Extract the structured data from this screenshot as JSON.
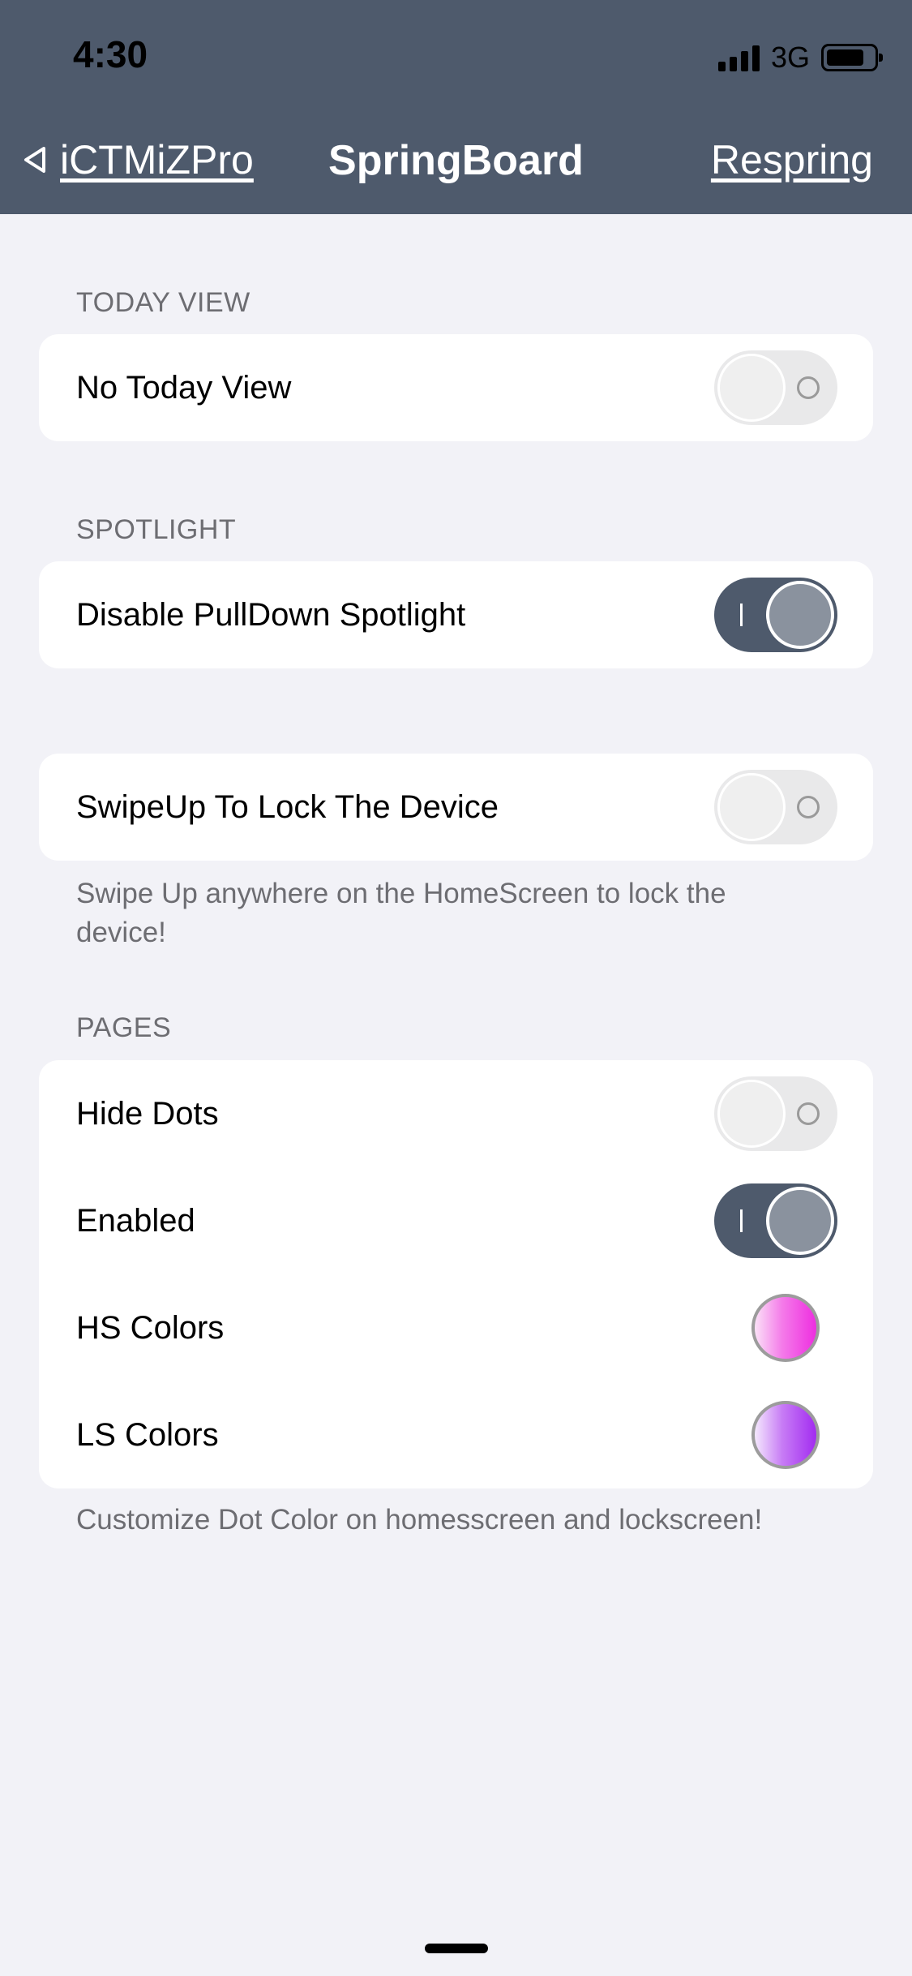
{
  "status_bar": {
    "time": "4:30",
    "network": "3G"
  },
  "nav": {
    "back_label": "iCTMiZPro",
    "title": "SpringBoard",
    "action_label": "Respring"
  },
  "sections": {
    "today_view": {
      "header": "TODAY VIEW",
      "rows": [
        {
          "label": "No Today View",
          "toggle_on": false
        }
      ]
    },
    "spotlight": {
      "header": "SPOTLIGHT",
      "rows": [
        {
          "label": "Disable PullDown Spotlight",
          "toggle_on": true
        }
      ]
    },
    "lock": {
      "rows": [
        {
          "label": "SwipeUp To Lock The Device",
          "toggle_on": false
        }
      ],
      "footer": "Swipe Up anywhere on the HomeScreen to lock the device!"
    },
    "pages": {
      "header": "PAGES",
      "rows": [
        {
          "label": "Hide Dots",
          "toggle_on": false
        },
        {
          "label": "Enabled",
          "toggle_on": true
        },
        {
          "label": "HS Colors",
          "swatch_color": "#ee2ee0"
        },
        {
          "label": "LS Colors",
          "swatch_color": "#a22cf0"
        }
      ],
      "footer": "Customize Dot Color on homesscreen and lockscreen!"
    }
  },
  "colors": {
    "accent": "#4e5a6c",
    "background": "#f2f2f7"
  }
}
